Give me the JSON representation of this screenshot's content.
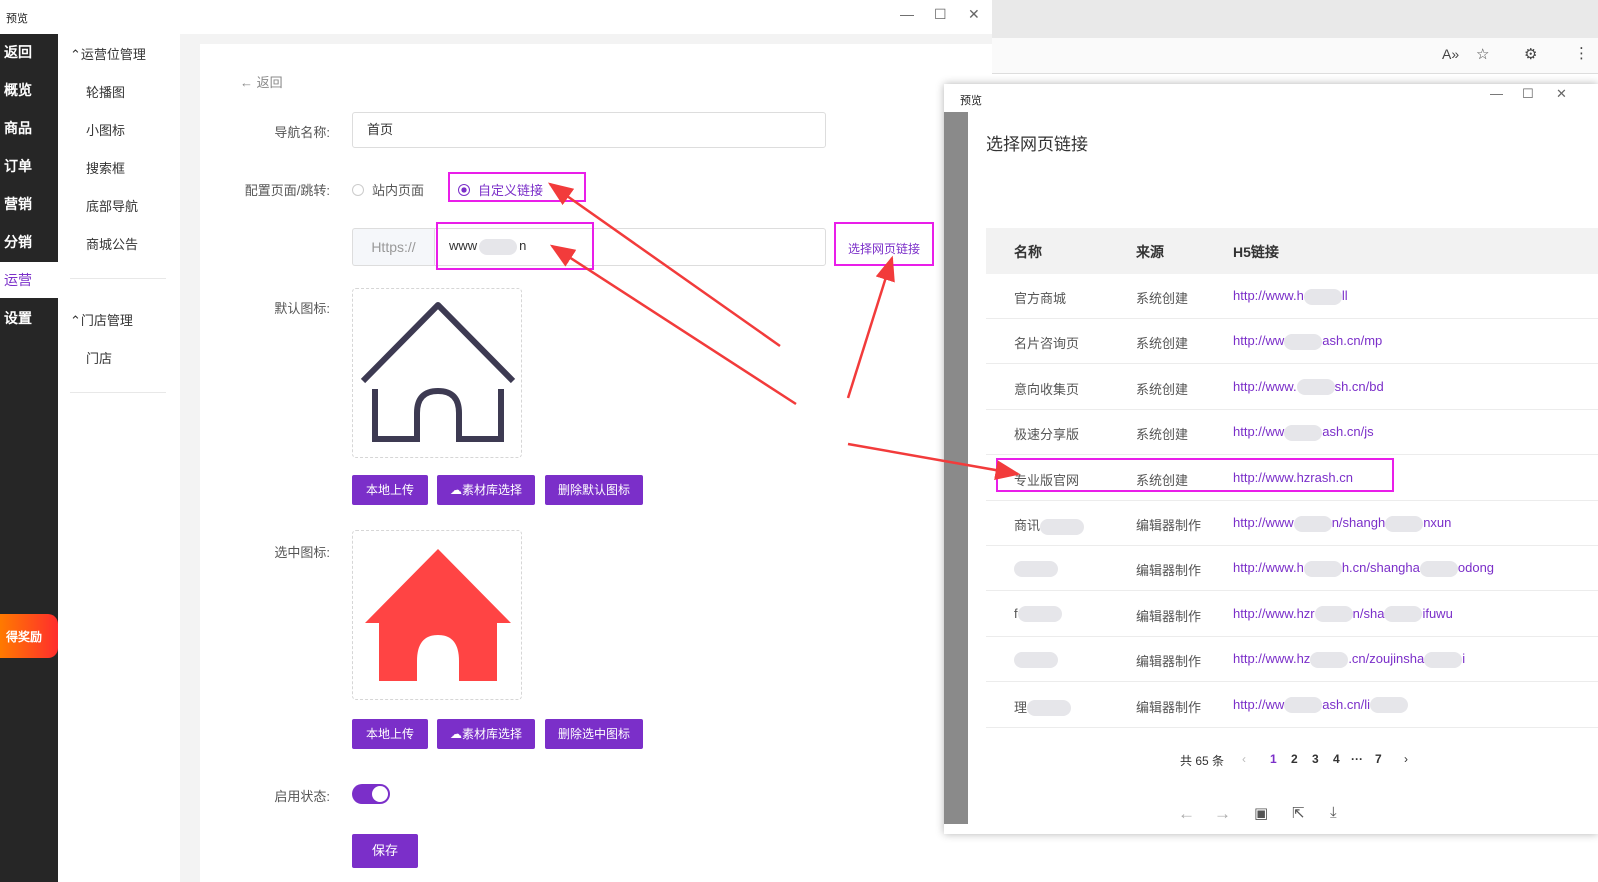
{
  "main_window": {
    "title": "预览"
  },
  "left_nav": {
    "items": [
      "返回",
      "概览",
      "商品",
      "订单",
      "营销",
      "分销",
      "运营",
      "设置"
    ],
    "active": "运营",
    "reward_text": "得奖励"
  },
  "sub_menu": {
    "groups": [
      {
        "title": "运营位管理",
        "items": [
          "轮播图",
          "小图标",
          "搜索框",
          "底部导航",
          "商城公告"
        ]
      },
      {
        "title": "门店管理",
        "items": [
          "门店"
        ]
      }
    ]
  },
  "form": {
    "back_label": "返回",
    "nav_name_label": "导航名称:",
    "nav_name_value": "首页",
    "config_label": "配置页面/跳转:",
    "radio_internal": "站内页面",
    "radio_custom": "自定义链接",
    "url_prefix": "Https://",
    "url_value": "www",
    "url_value_tail": "n",
    "select_link_button": "选择网页链接",
    "default_icon_label": "默认图标:",
    "selected_icon_label": "选中图标:",
    "upload_local": "本地上传",
    "library_select": "素材库选择",
    "delete_default": "删除默认图标",
    "delete_selected": "删除选中图标",
    "enable_label": "启用状态:",
    "save_label": "保存"
  },
  "dialog": {
    "title": "预览",
    "heading": "选择网页链接",
    "columns": [
      "名称",
      "来源",
      "H5链接"
    ],
    "rows": [
      {
        "name": "官方商城",
        "source": "系统创建",
        "link": "http://www.h",
        "link_tail": "ll"
      },
      {
        "name": "名片咨询页",
        "source": "系统创建",
        "link": "http://ww",
        "link_tail": "ash.cn/mp"
      },
      {
        "name": "意向收集页",
        "source": "系统创建",
        "link": "http://www.",
        "link_tail": "sh.cn/bd"
      },
      {
        "name": "极速分享版",
        "source": "系统创建",
        "link": "http://ww",
        "link_tail": "ash.cn/js"
      },
      {
        "name": "专业版官网",
        "source": "系统创建",
        "link": "http://www.hzrash.cn",
        "link_tail": ""
      },
      {
        "name": "商讯",
        "source": "编辑器制作",
        "link": "http://www",
        "link_tail": "n/shangh",
        "link_end": "nxun"
      },
      {
        "name": "",
        "source": "编辑器制作",
        "link": "http://www.h",
        "link_tail": "h.cn/shangha",
        "link_end": "odong"
      },
      {
        "name": "f",
        "source": "编辑器制作",
        "link": "http://www.hzr",
        "link_tail": "n/sha",
        "link_end": "ifuwu"
      },
      {
        "name": "",
        "source": "编辑器制作",
        "link": "http://www.hz",
        "link_tail": ".cn/zoujinsha",
        "link_end": "i"
      },
      {
        "name": "理",
        "source": "编辑器制作",
        "link": "http://ww",
        "link_tail": "ash.cn/li",
        "link_end": ""
      }
    ],
    "pagination": {
      "total": "共 65 条",
      "pages": [
        "1",
        "2",
        "3",
        "4",
        "···",
        "7"
      ],
      "current": "1"
    }
  },
  "colors": {
    "accent": "#7b2fc9",
    "highlight": "#e91ee9",
    "arrow": "#f23b3b",
    "house_selected": "#ff4444",
    "house_default": "#3d3a52"
  }
}
